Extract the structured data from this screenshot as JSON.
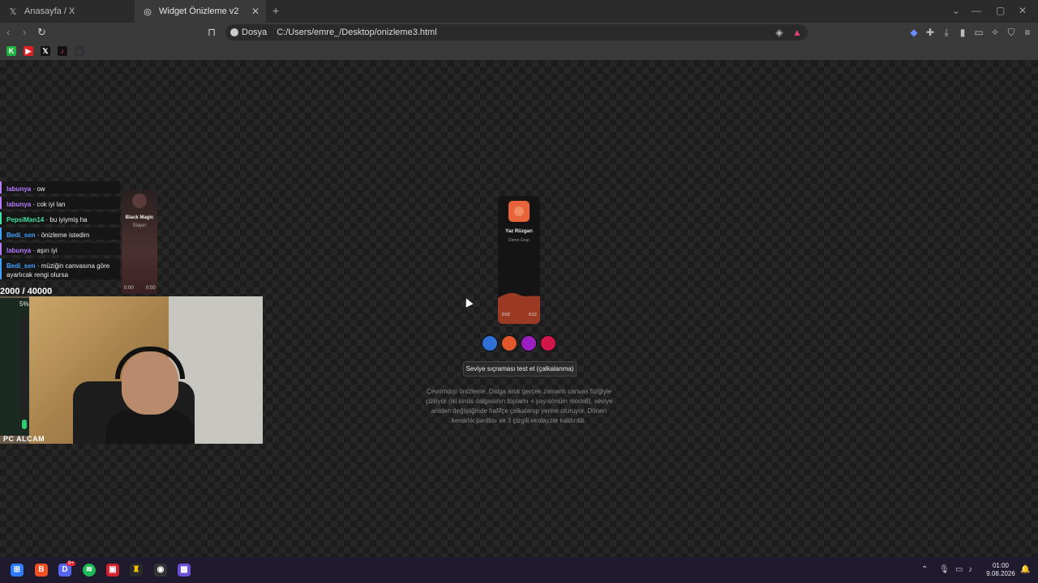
{
  "browser": {
    "tabs": [
      {
        "label": "Anasayfa / X",
        "icon": "x-logo-icon"
      },
      {
        "label": "Widget Önizleme v2",
        "icon": "globe-icon",
        "active": true
      }
    ],
    "new_tab_label": "+",
    "address": {
      "scheme_label": "Dosya",
      "url": "C:/Users/emre_/Desktop/onizleme3.html"
    }
  },
  "chat": {
    "messages": [
      {
        "user": "labunya",
        "text": "· ow",
        "color": "#b57cff"
      },
      {
        "user": "labunya",
        "text": "· cok iyi lan",
        "color": "#b57cff"
      },
      {
        "user": "PepsiMan14",
        "text": "· bu iyiymiş ha",
        "color": "#3fe0a0"
      },
      {
        "user": "Bedi_sen",
        "text": "· önizleme istedim",
        "color": "#3fa0ff"
      },
      {
        "user": "labunya",
        "text": "· aşırı iyi",
        "color": "#b57cff"
      },
      {
        "user": "Bedi_sen",
        "text": "· müziğin canvasına göre ayarlıcak rengi olursa",
        "color": "#3fa0ff"
      }
    ]
  },
  "mini_player": {
    "title": "Black Magic",
    "artist": "Slayer",
    "time_left": "0:00",
    "time_right": "0:00"
  },
  "stream": {
    "counter": "2000 / 40000",
    "level_percent": "5%",
    "cam_label": "PC ALCAM"
  },
  "widget": {
    "title": "Yaz Rüzgarı",
    "artist": "Demo Grup",
    "time_elapsed": "0:02",
    "time_total": "0:12",
    "accent": "#e8633a"
  },
  "swatches": [
    "#2f6fd6",
    "#e0572b",
    "#9b1fc0",
    "#d0164a"
  ],
  "test_button_label": "Seviye sıçraması test et (çalkalanma)",
  "description": "Çevrimdışı önizleme. Dalga artık gerçek zamanlı canvas fiziğiyle çiziliyor (iki sinüs dalgasının toplamı + yay-sönüm modeli), seviye aniden değiştiğinde hafifçe çalkalanıp yerine oturuyor. Dönen kenarlık panltısı ve 3 çizgili ekolayzer kaldırıldı.",
  "taskbar": {
    "time": "01:00",
    "date": "9.08.2026",
    "discord_badge": "9+"
  }
}
